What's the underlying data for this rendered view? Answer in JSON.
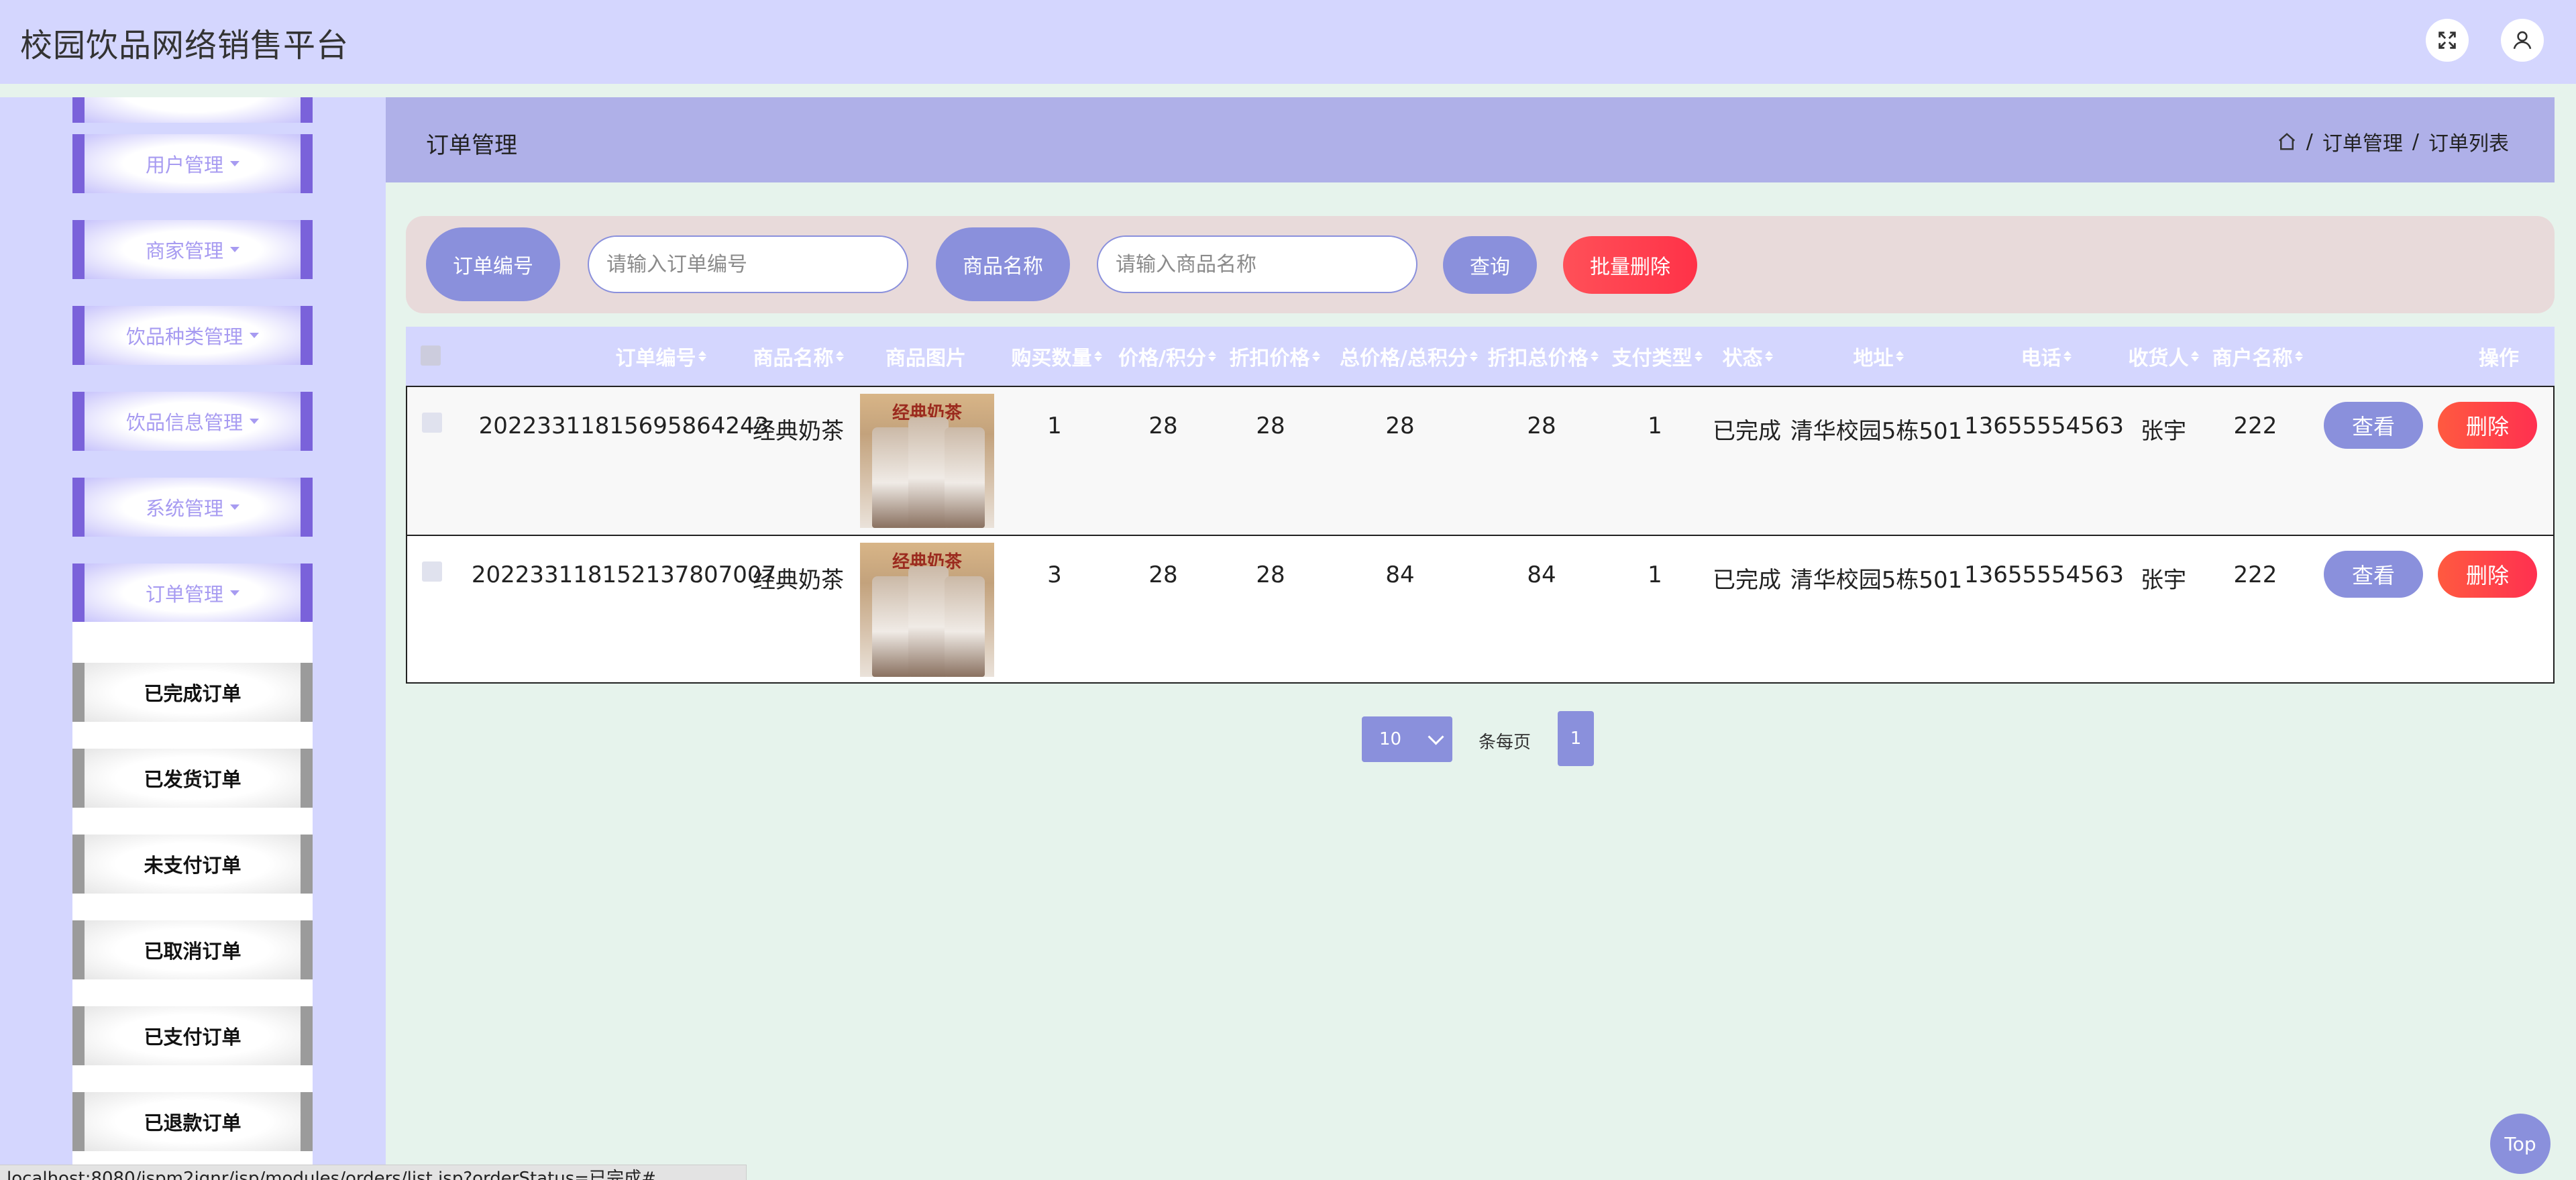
{
  "app": {
    "title": "校园饮品网络销售平台"
  },
  "header_icons": [
    "fullscreen-icon",
    "user-icon"
  ],
  "sidebar": {
    "menus": [
      {
        "label": "用户管理"
      },
      {
        "label": "商家管理"
      },
      {
        "label": "饮品种类管理"
      },
      {
        "label": "饮品信息管理"
      },
      {
        "label": "系统管理"
      },
      {
        "label": "订单管理"
      }
    ],
    "sub_items": [
      {
        "label": "已完成订单"
      },
      {
        "label": "已发货订单"
      },
      {
        "label": "未支付订单"
      },
      {
        "label": "已取消订单"
      },
      {
        "label": "已支付订单"
      },
      {
        "label": "已退款订单"
      }
    ]
  },
  "page": {
    "title": "订单管理",
    "breadcrumb": [
      "订单管理",
      "订单列表"
    ]
  },
  "search": {
    "order_no_label": "订单编号",
    "order_no_placeholder": "请输入订单编号",
    "product_label": "商品名称",
    "product_placeholder": "请输入商品名称",
    "query_label": "查询",
    "batch_delete_label": "批量删除"
  },
  "table": {
    "columns": [
      "订单编号",
      "商品名称",
      "商品图片",
      "购买数量",
      "价格/积分",
      "折扣价格",
      "总价格/总积分",
      "折扣总价格",
      "支付类型",
      "状态",
      "地址",
      "电话",
      "收货人",
      "商户名称",
      "操作"
    ],
    "rows": [
      {
        "order_no": "20223311815695864243",
        "product": "经典奶茶",
        "image_text": "经典奶茶",
        "qty": "1",
        "price": "28",
        "discount_price": "28",
        "total": "28",
        "discount_total": "28",
        "pay_type": "1",
        "status": "已完成",
        "address": "清华校园5栋501",
        "phone": "13655554563",
        "receiver": "张宇",
        "merchant": "222"
      },
      {
        "order_no": "20223311815213780700​7",
        "product": "经典奶茶",
        "image_text": "经典奶茶",
        "qty": "3",
        "price": "28",
        "discount_price": "28",
        "total": "84",
        "discount_total": "84",
        "pay_type": "1",
        "status": "已完成",
        "address": "清华校园5栋501",
        "phone": "13655554563",
        "receiver": "张宇",
        "merchant": "222"
      }
    ],
    "actions": {
      "view": "查看",
      "delete": "删除"
    }
  },
  "pagination": {
    "page_size": "10",
    "per_page_label": "条每页",
    "current_page": "1"
  },
  "top_button": "Top",
  "status_bar": "localhost:8080/jspm2jqnr/jsp/modules/orders/list.jsp?orderStatus=已完成#"
}
